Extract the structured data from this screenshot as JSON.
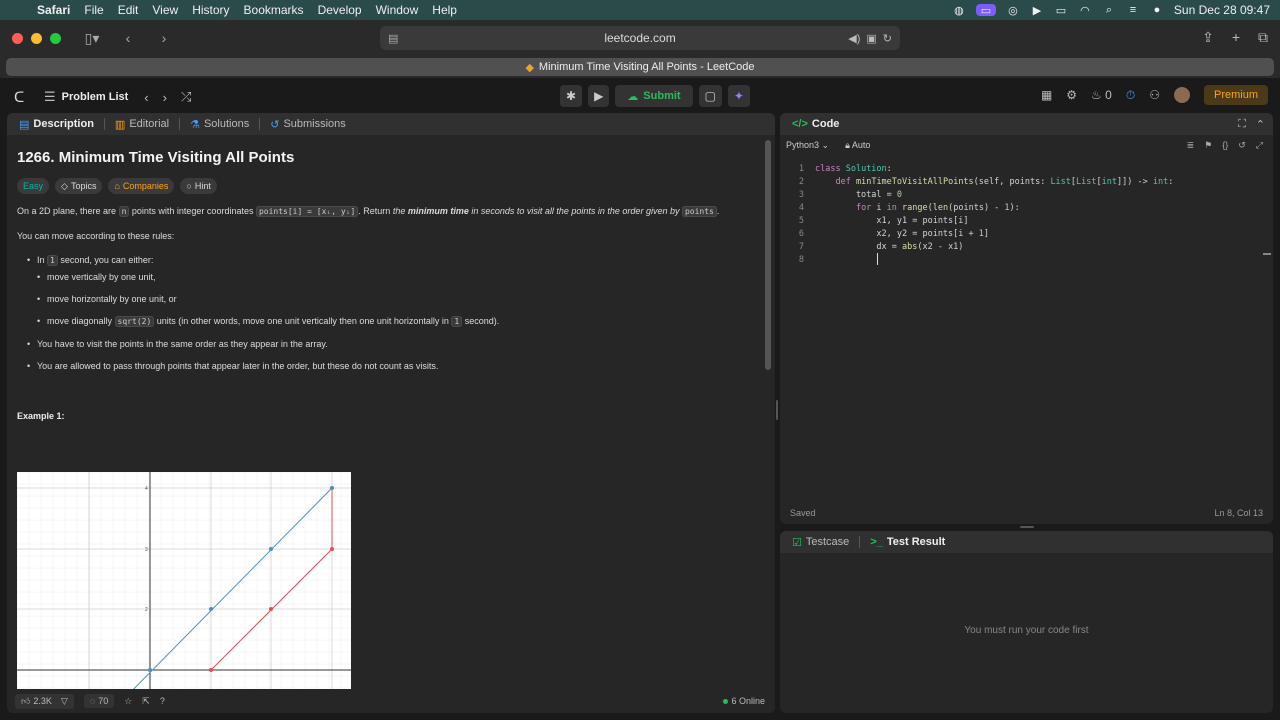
{
  "menubar": {
    "app": "Safari",
    "items": [
      "File",
      "Edit",
      "View",
      "History",
      "Bookmarks",
      "Develop",
      "Window",
      "Help"
    ],
    "clock": "Sun Dec 28  09:47"
  },
  "browser": {
    "url": "leetcode.com",
    "tab_title": "Minimum Time Visiting All Points - LeetCode"
  },
  "nav": {
    "problem_list": "Problem List",
    "submit": "Submit",
    "notifications": "0",
    "premium": "Premium"
  },
  "description": {
    "tabs": [
      "Description",
      "Editorial",
      "Solutions",
      "Submissions"
    ],
    "title": "1266. Minimum Time Visiting All Points",
    "tags": {
      "difficulty": "Easy",
      "topics": "Topics",
      "companies": "Companies",
      "hint": "Hint"
    },
    "statement": {
      "p1": "On a 2D plane, there are ",
      "n": "n",
      "p2": " points with integer coordinates ",
      "coord": "points[i] = [xᵢ, yᵢ]",
      "p3": ". Return ",
      "p4": "the ",
      "p5": "minimum time",
      "p6": " in seconds to visit all the points in the order given by ",
      "points": "points",
      "p7": "."
    },
    "rules_intro": "You can move according to these rules:",
    "rules": {
      "r1_a": "In ",
      "r1_one": "1",
      "r1_b": " second, you can either:",
      "sub1": "move vertically by one unit,",
      "sub2": "move horizontally by one unit, or",
      "sub3_a": "move diagonally ",
      "sub3_sqrt": "sqrt(2)",
      "sub3_b": " units (in other words, move one unit vertically then one unit horizontally in ",
      "sub3_one": "1",
      "sub3_c": " second).",
      "r2": "You have to visit the points in the same order as they appear in the array.",
      "r3": "You are allowed to pass through points that appear later in the order, but these do not count as visits."
    },
    "example_title": "Example 1:",
    "footer": {
      "likes": "2.3K",
      "comments": "70",
      "online": "6 Online"
    }
  },
  "code": {
    "header": "Code",
    "language": "Python3",
    "mode": "Auto",
    "status": "Saved",
    "position": "Ln 8, Col 13"
  },
  "test": {
    "tabs": [
      "Testcase",
      "Test Result"
    ],
    "empty_message": "You must run your code first"
  },
  "figure": {
    "tick_labels": [
      "4",
      "3",
      "2"
    ],
    "blue_color": "#4a90c2",
    "red_color": "#d9534f"
  }
}
